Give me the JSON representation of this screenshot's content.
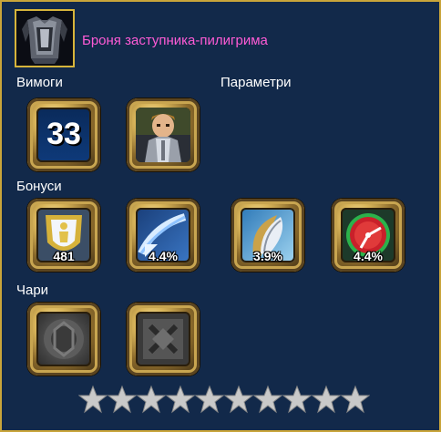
{
  "item": {
    "title": "Броня заступника-пилигрима",
    "icon": "armor-chestplate-icon"
  },
  "sections": {
    "requirements": "Вимоги",
    "parameters": "Параметри",
    "bonuses": "Бонуси",
    "enchants": "Чари"
  },
  "requirements": {
    "level": "33",
    "portrait_icon": "knight-portrait-icon"
  },
  "bonuses": [
    {
      "icon": "shield-defense-icon",
      "value": "481"
    },
    {
      "icon": "slash-arrow-icon",
      "value": "4.4%"
    },
    {
      "icon": "blade-icon",
      "value": "3.9%"
    },
    {
      "icon": "speed-gauge-icon",
      "value": "4.4%"
    }
  ],
  "enchants": [
    {
      "icon": "enchant-slot-empty-icon"
    },
    {
      "icon": "enchant-slot-rune-icon"
    }
  ],
  "stars": {
    "count": 10,
    "color": "#c9c9c9"
  },
  "colors": {
    "title": "#ff5bd6",
    "border": "#c9a53a",
    "background": "#12294a"
  }
}
